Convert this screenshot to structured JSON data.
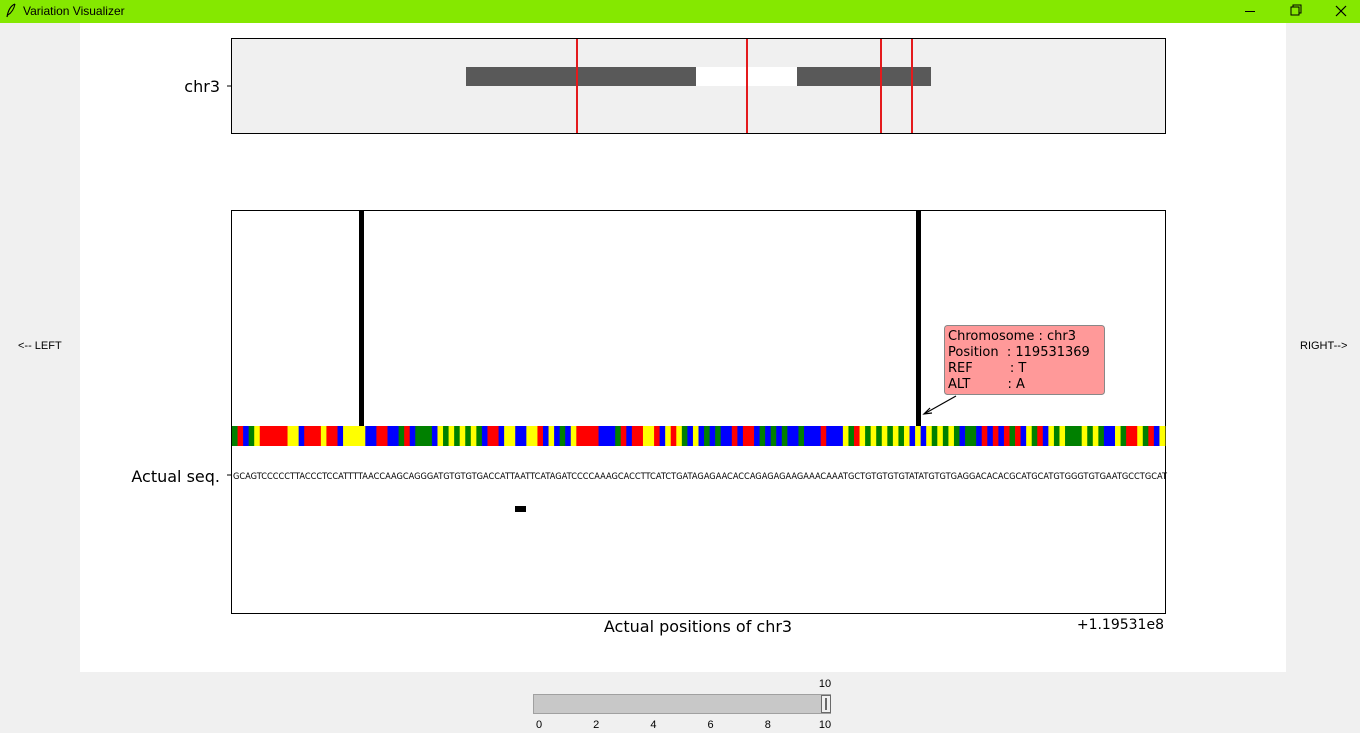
{
  "window": {
    "title": "Variation Visualizer"
  },
  "nav": {
    "left_label": "<-- LEFT",
    "right_label": "RIGHT-->"
  },
  "overview": {
    "ylabel": "chr3",
    "ref_line_color": "#e41a1c",
    "bar_color": "#595959"
  },
  "main": {
    "ylabel": "Actual seq.",
    "xlabel": "Actual positions of chr3",
    "offset_label": "+1.19531e8",
    "sequence": "GCAGTCCCCCTTACCCTCCATTTTAACCAAGCAGGGATGTGTGTGACCATTAATTCATAGATCCCCAAAGCACCTTCATCTGATAGAGAACACCAGAGAGAAGAAACAAATGCTGTGTGTGTATATGTGTGAGGACACACGCATGCATGTGGGTGTGAATGCCTGCAT",
    "base_colors": {
      "A": "#0000ff",
      "C": "#ff0000",
      "G": "#008000",
      "T": "#ffff00"
    }
  },
  "tooltip": {
    "line1": "Chromosome : chr3",
    "line2": "Position  : 119531369",
    "line3": "REF         : T",
    "line4": "ALT         : A"
  },
  "slider": {
    "value": "10",
    "min": 0,
    "max": 10,
    "ticks": [
      "0",
      "2",
      "4",
      "6",
      "8",
      "10"
    ]
  }
}
